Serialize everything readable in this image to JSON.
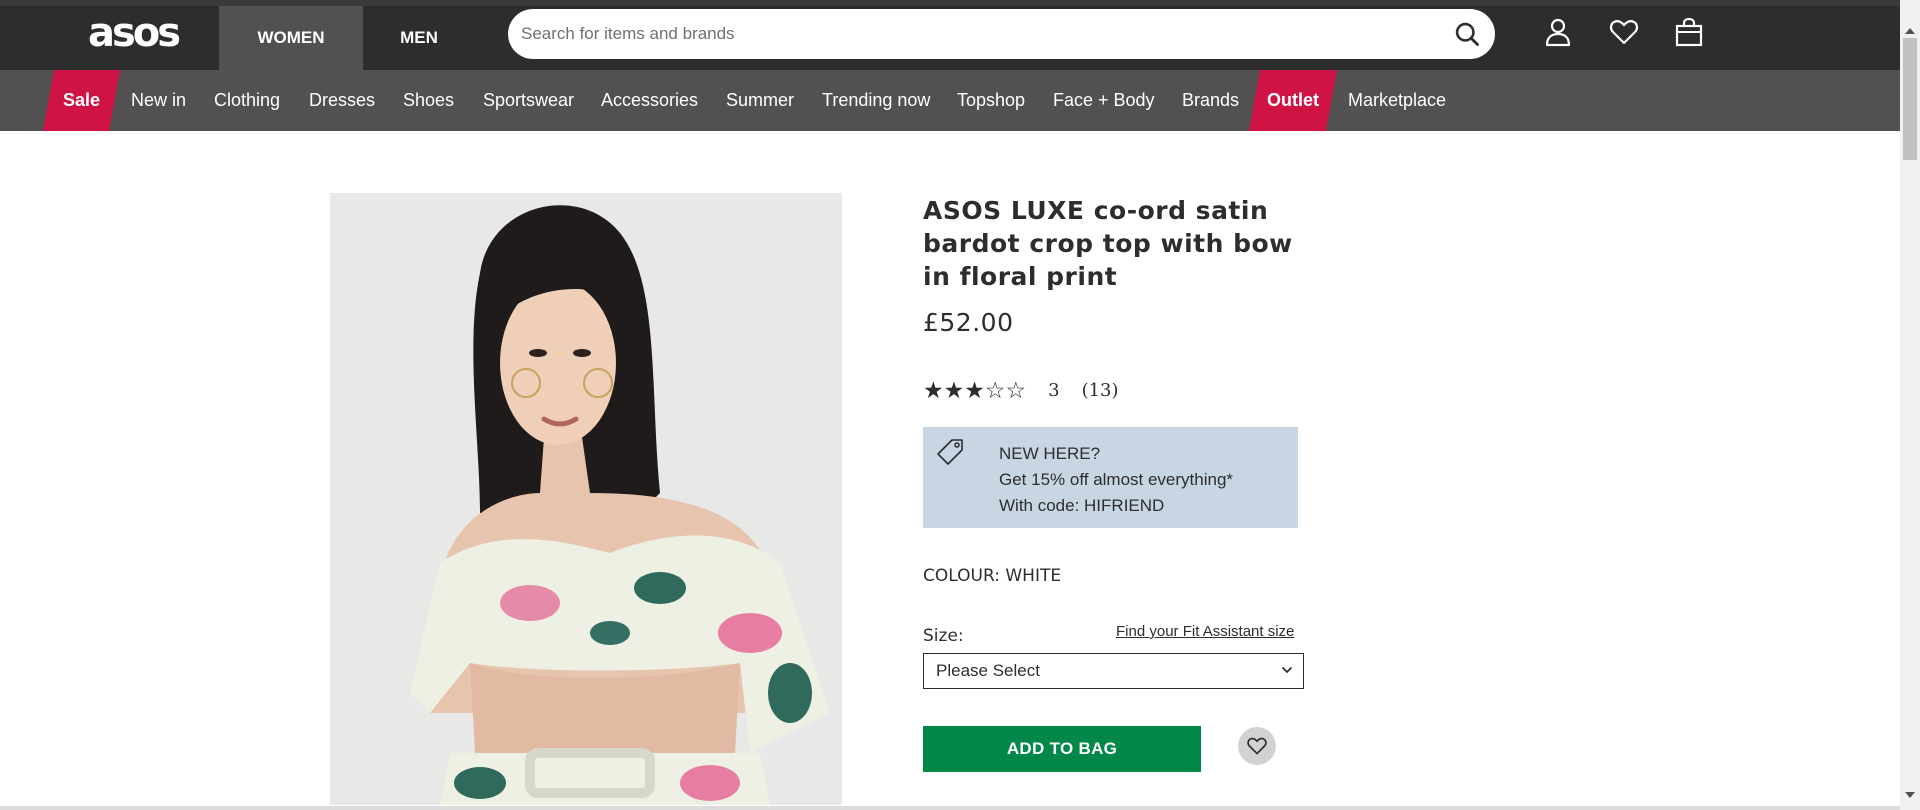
{
  "header": {
    "logo": "asos",
    "gender_tabs": [
      "WOMEN",
      "MEN"
    ],
    "search_placeholder": "Search for items and brands",
    "icons": [
      "search-icon",
      "account-icon",
      "heart-icon",
      "bag-icon"
    ]
  },
  "nav": {
    "items": [
      "Sale",
      "New in",
      "Clothing",
      "Dresses",
      "Shoes",
      "Sportswear",
      "Accessories",
      "Summer",
      "Trending now",
      "Topshop",
      "Face + Body",
      "Brands",
      "Outlet",
      "Marketplace"
    ]
  },
  "product": {
    "title": "ASOS LUXE co-ord satin bardot crop top with bow in floral print",
    "price": "£52.00",
    "rating": {
      "stars_filled": 3,
      "stars_total": 5,
      "value": "3",
      "count": "(13)"
    },
    "promo": {
      "line1": "NEW HERE?",
      "line2": "Get 15% off almost everything*",
      "line3": "With code: HIFRIEND"
    },
    "colour_label": "COLOUR:",
    "colour_value": "WHITE",
    "size_label": "Size:",
    "fit_link": "Find your Fit Assistant size",
    "size_select_value": "Please Select",
    "add_to_bag": "ADD TO BAG"
  },
  "colors": {
    "header_dark": "#2d2d2d",
    "nav_grey": "#525050",
    "sale_red": "#d01345",
    "add_green": "#018849",
    "promo_blue": "#c8d6e4"
  }
}
